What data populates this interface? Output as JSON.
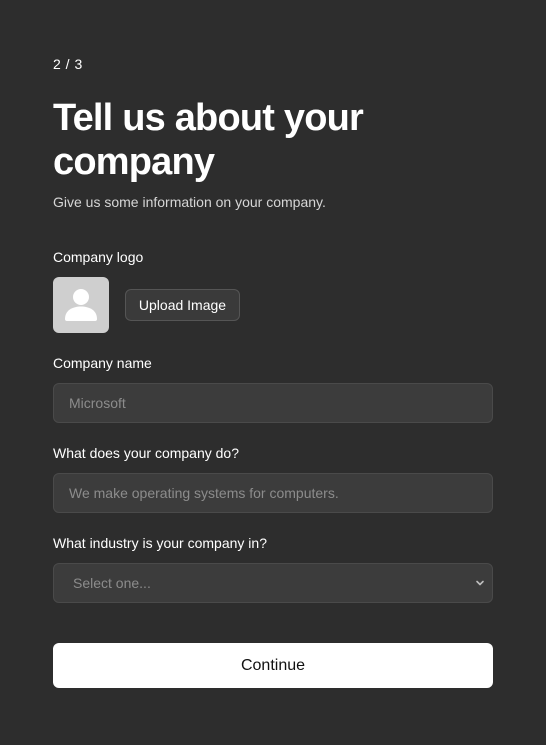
{
  "header": {
    "step": "2 / 3",
    "title": "Tell us about your company",
    "subtitle": "Give us some information on your company."
  },
  "logo": {
    "label": "Company logo",
    "placeholder_icon": "user-silhouette-icon",
    "upload_label": "Upload Image"
  },
  "company_name": {
    "label": "Company name",
    "placeholder": "Microsoft",
    "value": ""
  },
  "company_description": {
    "label": "What does your company do?",
    "placeholder": "We make operating systems for computers.",
    "value": ""
  },
  "industry": {
    "label": "What industry is your company in?",
    "selected": "Select one...",
    "icon": "chevron-down-icon"
  },
  "actions": {
    "continue_label": "Continue"
  },
  "colors": {
    "background": "#2d2d2d",
    "field_background": "#3c3c3c",
    "primary_button": "#ffffff",
    "avatar_background": "#cfcfcf"
  }
}
